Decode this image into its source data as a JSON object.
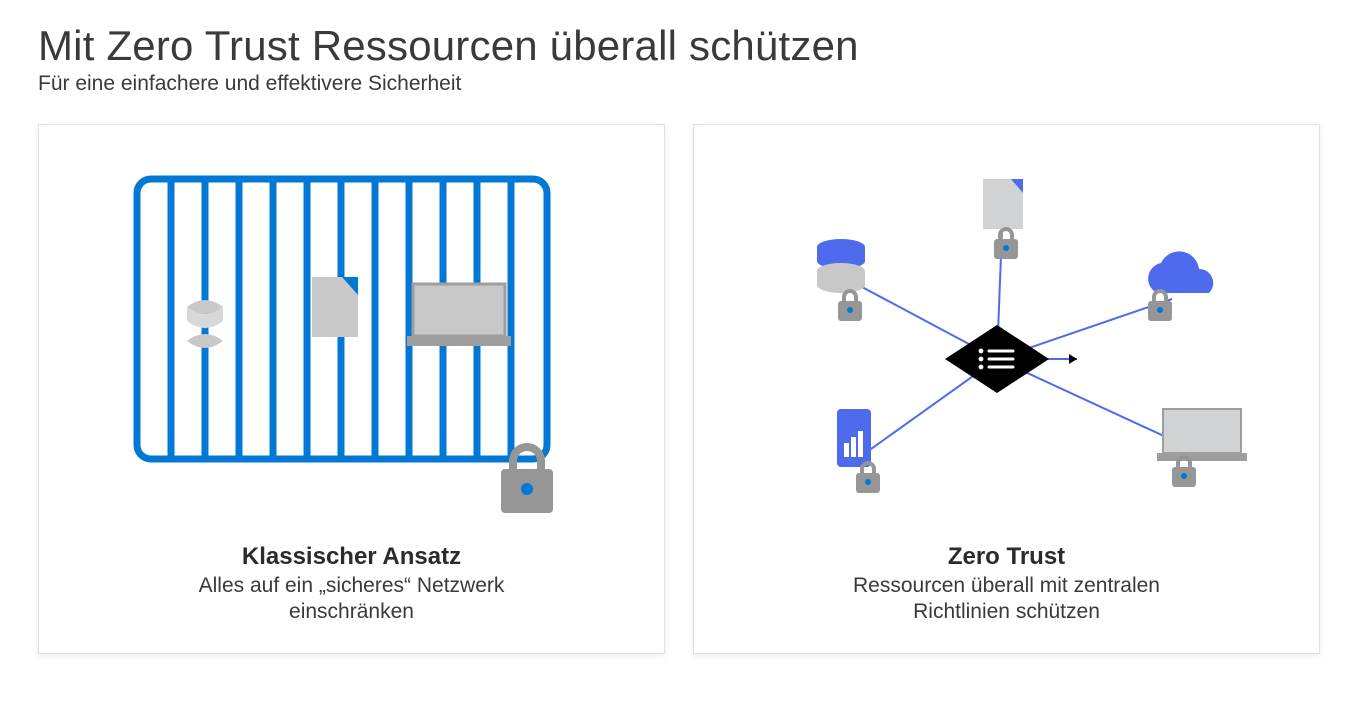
{
  "header": {
    "title": "Mit Zero Trust Ressourcen überall schützen",
    "subtitle": "Für eine einfachere und effektivere Sicherheit"
  },
  "cards": {
    "classic": {
      "title": "Klassischer Ansatz",
      "text_line1": "Alles auf ein „sicheres“ Netzwerk",
      "text_line2": "einschränken"
    },
    "zero_trust": {
      "title": "Zero Trust",
      "text_line1": "Ressourcen überall mit zentralen",
      "text_line2": "Richtlinien schützen"
    }
  },
  "colors": {
    "brand_blue": "#0078d4",
    "mid_blue": "#4f6bed",
    "light_gray": "#c8c8c8",
    "gray_fill": "#d0d2d4",
    "dark": "#000000"
  },
  "icons": {
    "classic_items": [
      "database-icon",
      "document-icon",
      "laptop-icon"
    ],
    "zero_trust_nodes": [
      "database-icon",
      "document-icon",
      "cloud-icon",
      "phone-icon",
      "laptop-icon"
    ],
    "center": "policy-hub-icon",
    "lock": "lock-icon"
  }
}
